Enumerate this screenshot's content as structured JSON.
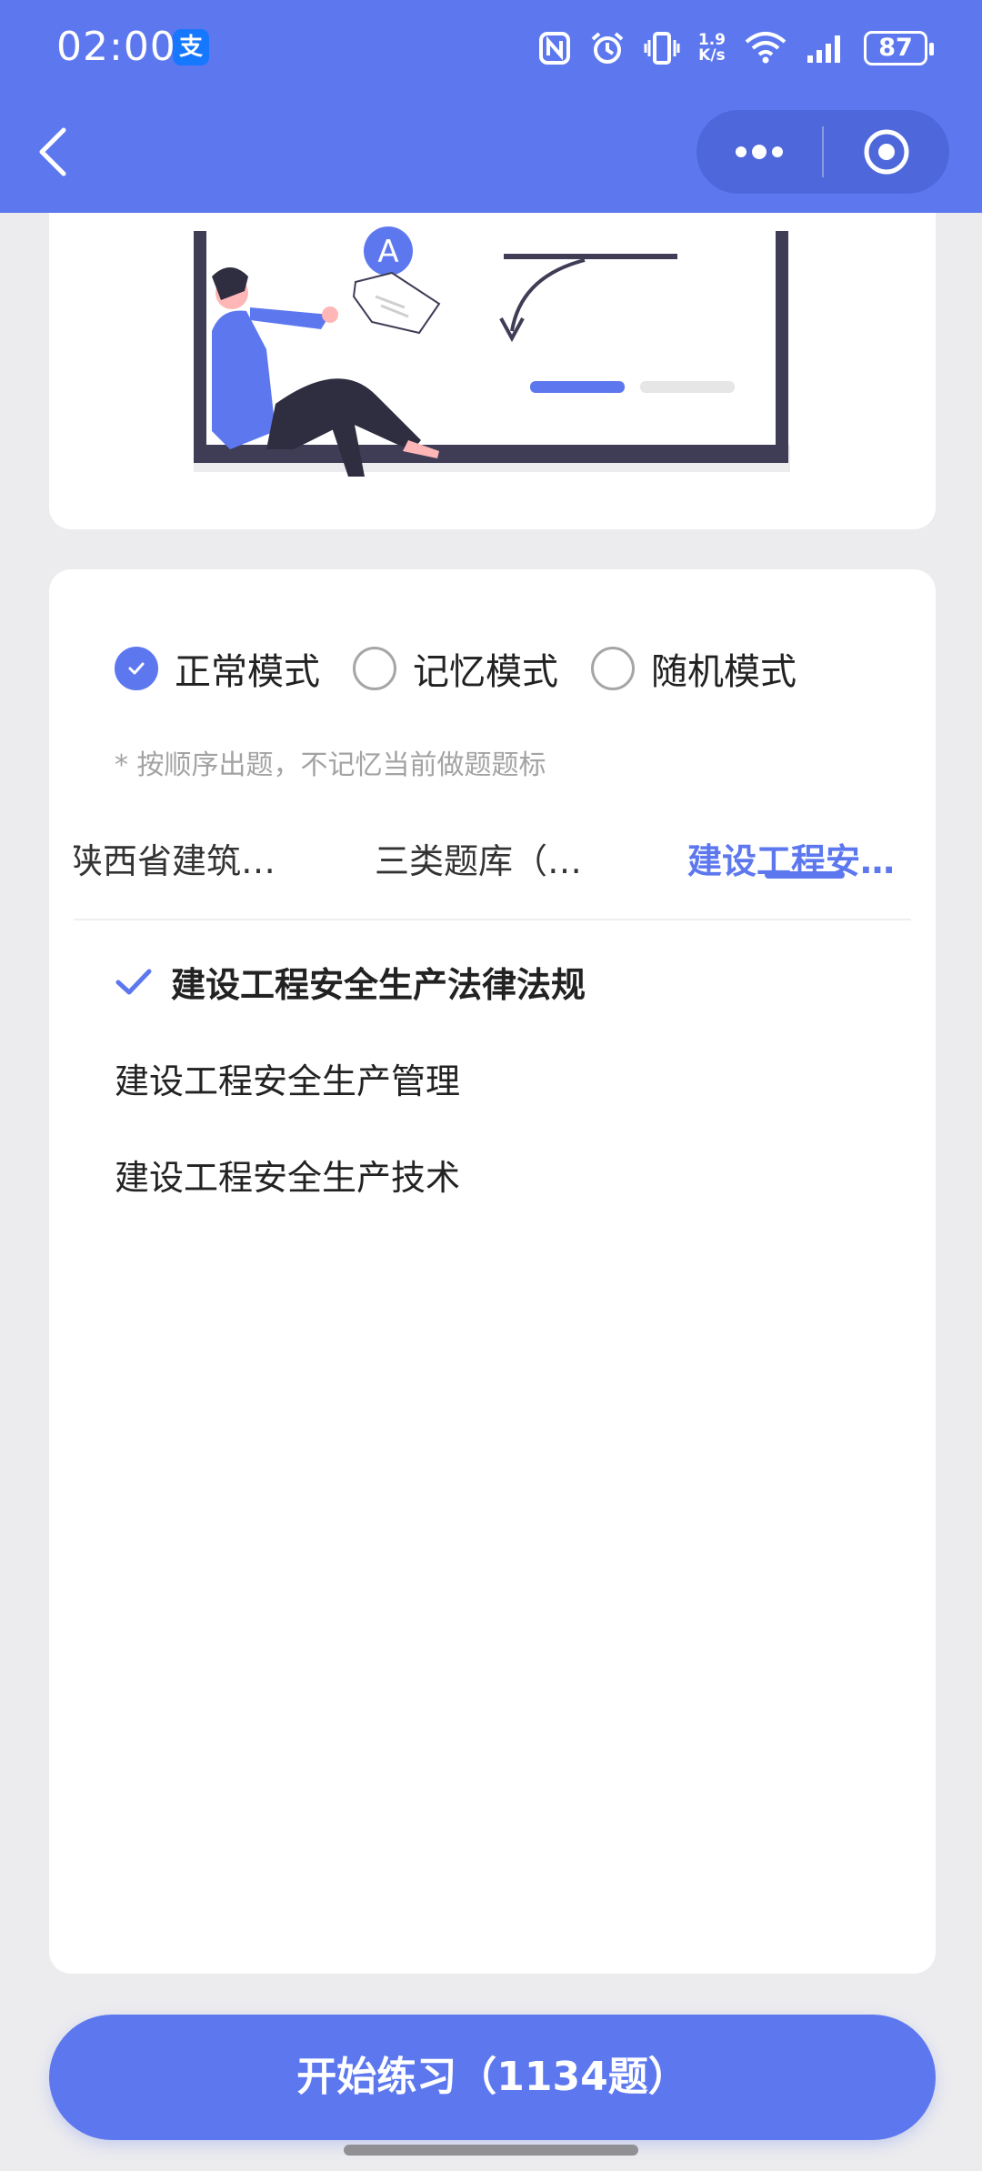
{
  "status_bar": {
    "time": "02:00",
    "app_badge": "支",
    "net_speed_value": "1.9",
    "net_speed_unit": "K/s",
    "battery": "87"
  },
  "nav": {
    "back_icon": "chevron-left-icon",
    "more_icon": "more-dots-icon",
    "close_icon": "target-circle-icon"
  },
  "hero": {
    "badge_letter": "A"
  },
  "modes": {
    "options": [
      {
        "label": "正常模式",
        "checked": true
      },
      {
        "label": "记忆模式",
        "checked": false
      },
      {
        "label": "随机模式",
        "checked": false
      }
    ],
    "hint": "* 按顺序出题，不记忆当前做题题标"
  },
  "tabs": [
    {
      "label": "陕西省建筑…",
      "active": false
    },
    {
      "label": "三类题库（…",
      "active": false
    },
    {
      "label": "建设工程安…",
      "active": true
    }
  ],
  "subjects": [
    {
      "label": "建设工程安全生产法律法规",
      "selected": true
    },
    {
      "label": "建设工程安全生产管理",
      "selected": false
    },
    {
      "label": "建设工程安全生产技术",
      "selected": false
    }
  ],
  "start_button": {
    "label": "开始练习（1134题）"
  },
  "colors": {
    "accent": "#5d78ef",
    "background": "#ececef"
  }
}
